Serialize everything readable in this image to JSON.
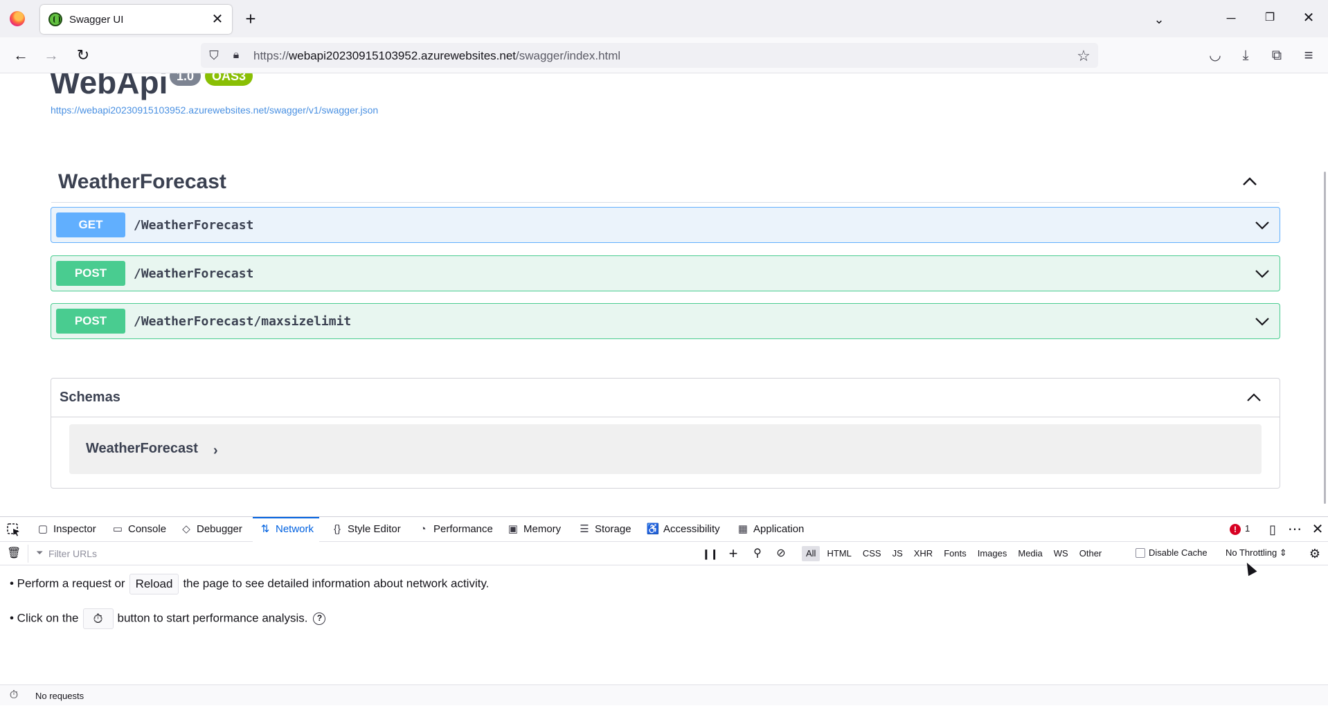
{
  "browser": {
    "tab_title": "Swagger UI",
    "tab_close": "✕",
    "new_tab": "+",
    "url_scheme": "https://",
    "url_host": "webapi20230915103952.azurewebsites.net",
    "url_path": "/swagger/index.html"
  },
  "swagger": {
    "title": "WebApi",
    "version": "1.0",
    "oas_badge": "OAS3",
    "spec_url": "https://webapi20230915103952.azurewebsites.net/swagger/v1/swagger.json",
    "tag": "WeatherForecast",
    "operations": [
      {
        "method": "GET",
        "path": "/WeatherForecast"
      },
      {
        "method": "POST",
        "path": "/WeatherForecast"
      },
      {
        "method": "POST",
        "path": "/WeatherForecast/maxsizelimit"
      }
    ],
    "schemas_title": "Schemas",
    "model_name": "WeatherForecast",
    "model_chevron": "›"
  },
  "devtools": {
    "tabs": [
      {
        "label": "Inspector",
        "icon": "▢"
      },
      {
        "label": "Console",
        "icon": "▭"
      },
      {
        "label": "Debugger",
        "icon": "◇"
      },
      {
        "label": "Network",
        "icon": "⇅"
      },
      {
        "label": "Style Editor",
        "icon": "{}"
      },
      {
        "label": "Performance",
        "icon": "◔"
      },
      {
        "label": "Memory",
        "icon": "▣"
      },
      {
        "label": "Storage",
        "icon": "☰"
      },
      {
        "label": "Accessibility",
        "icon": "♿"
      },
      {
        "label": "Application",
        "icon": "▦"
      }
    ],
    "error_count": "1",
    "filter_placeholder": "Filter URLs",
    "types": [
      "All",
      "HTML",
      "CSS",
      "JS",
      "XHR",
      "Fonts",
      "Images",
      "Media",
      "WS",
      "Other"
    ],
    "disable_cache": "Disable Cache",
    "throttling": "No Throttling ⇕",
    "hint1_pre": "• Perform a request or",
    "hint1_btn": "Reload",
    "hint1_post": "the page to see detailed information about network activity.",
    "hint2_pre": "• Click on the",
    "hint2_post": "button to start performance analysis.",
    "status": "No requests"
  },
  "colors": {
    "get": "#61affe",
    "post": "#49cc90",
    "network_active": "#0061e0"
  }
}
